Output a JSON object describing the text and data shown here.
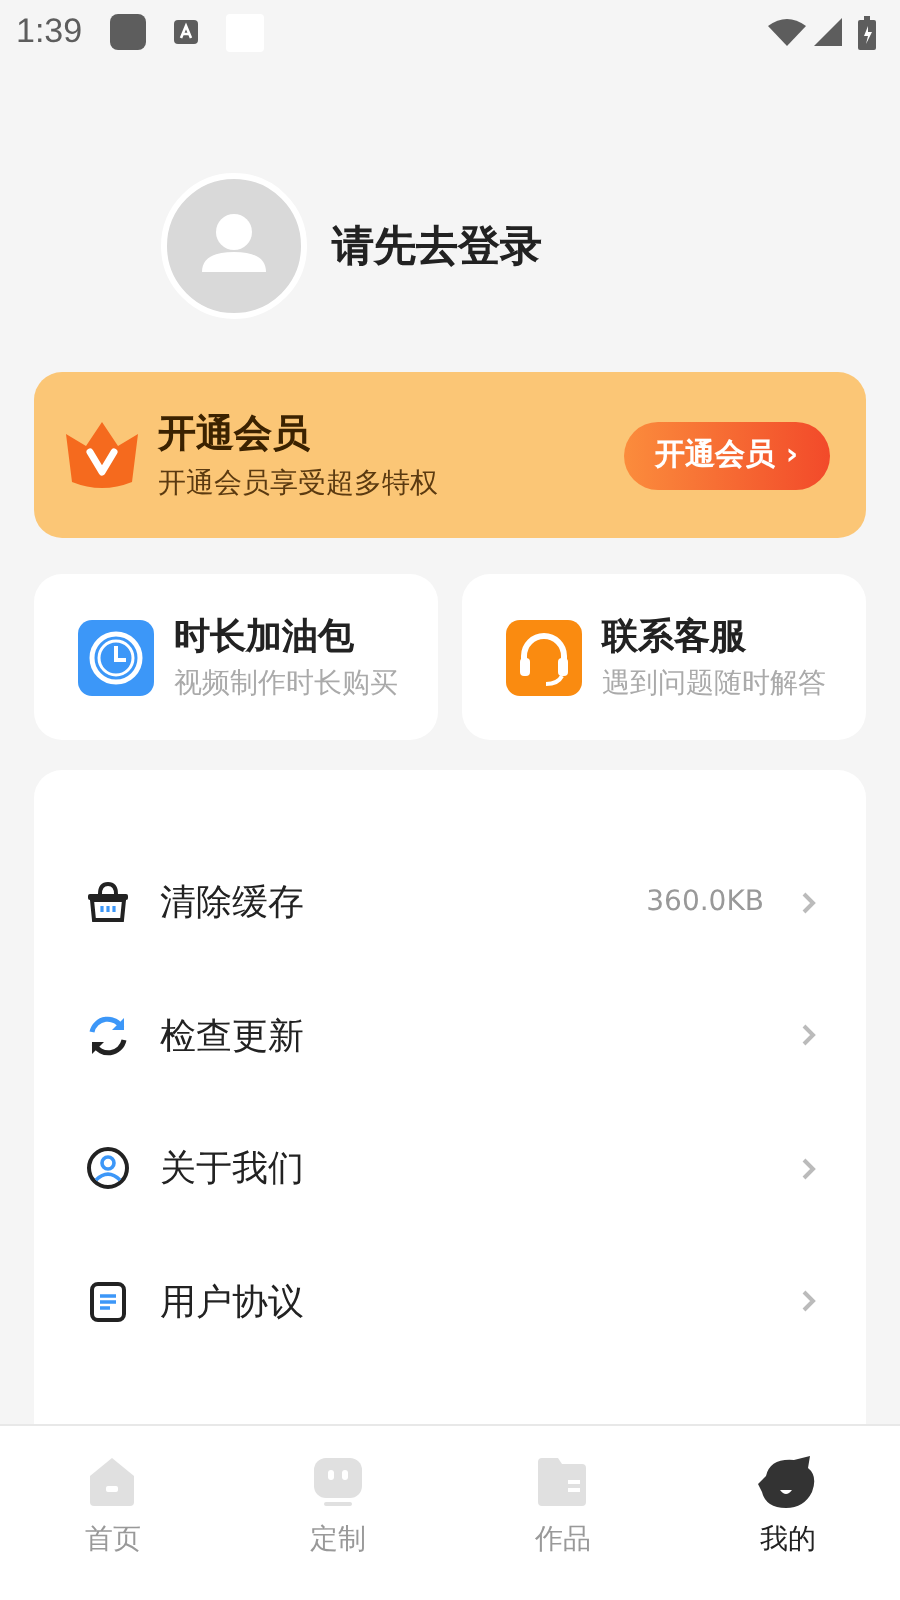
{
  "status_bar": {
    "time": "1:39"
  },
  "profile": {
    "login_prompt": "请先去登录"
  },
  "vip_banner": {
    "title": "开通会员",
    "subtitle": "开通会员享受超多特权",
    "button": "开通会员",
    "button_arrow": "›"
  },
  "feature_cards": [
    {
      "kind": "clock",
      "title": "时长加油包",
      "subtitle": "视频制作时长购买"
    },
    {
      "kind": "headset",
      "title": "联系客服",
      "subtitle": "遇到问题随时解答"
    }
  ],
  "menu": [
    {
      "kind": "basket",
      "label": "清除缓存",
      "value": "360.0KB"
    },
    {
      "kind": "refresh",
      "label": "检查更新"
    },
    {
      "kind": "person",
      "label": "关于我们"
    },
    {
      "kind": "document",
      "label": "用户协议"
    }
  ],
  "tabs": [
    {
      "kind": "home",
      "label": "首页",
      "selected": false
    },
    {
      "kind": "robot",
      "label": "定制",
      "selected": false
    },
    {
      "kind": "folder",
      "label": "作品",
      "selected": false
    },
    {
      "kind": "face",
      "label": "我的",
      "selected": true
    }
  ]
}
